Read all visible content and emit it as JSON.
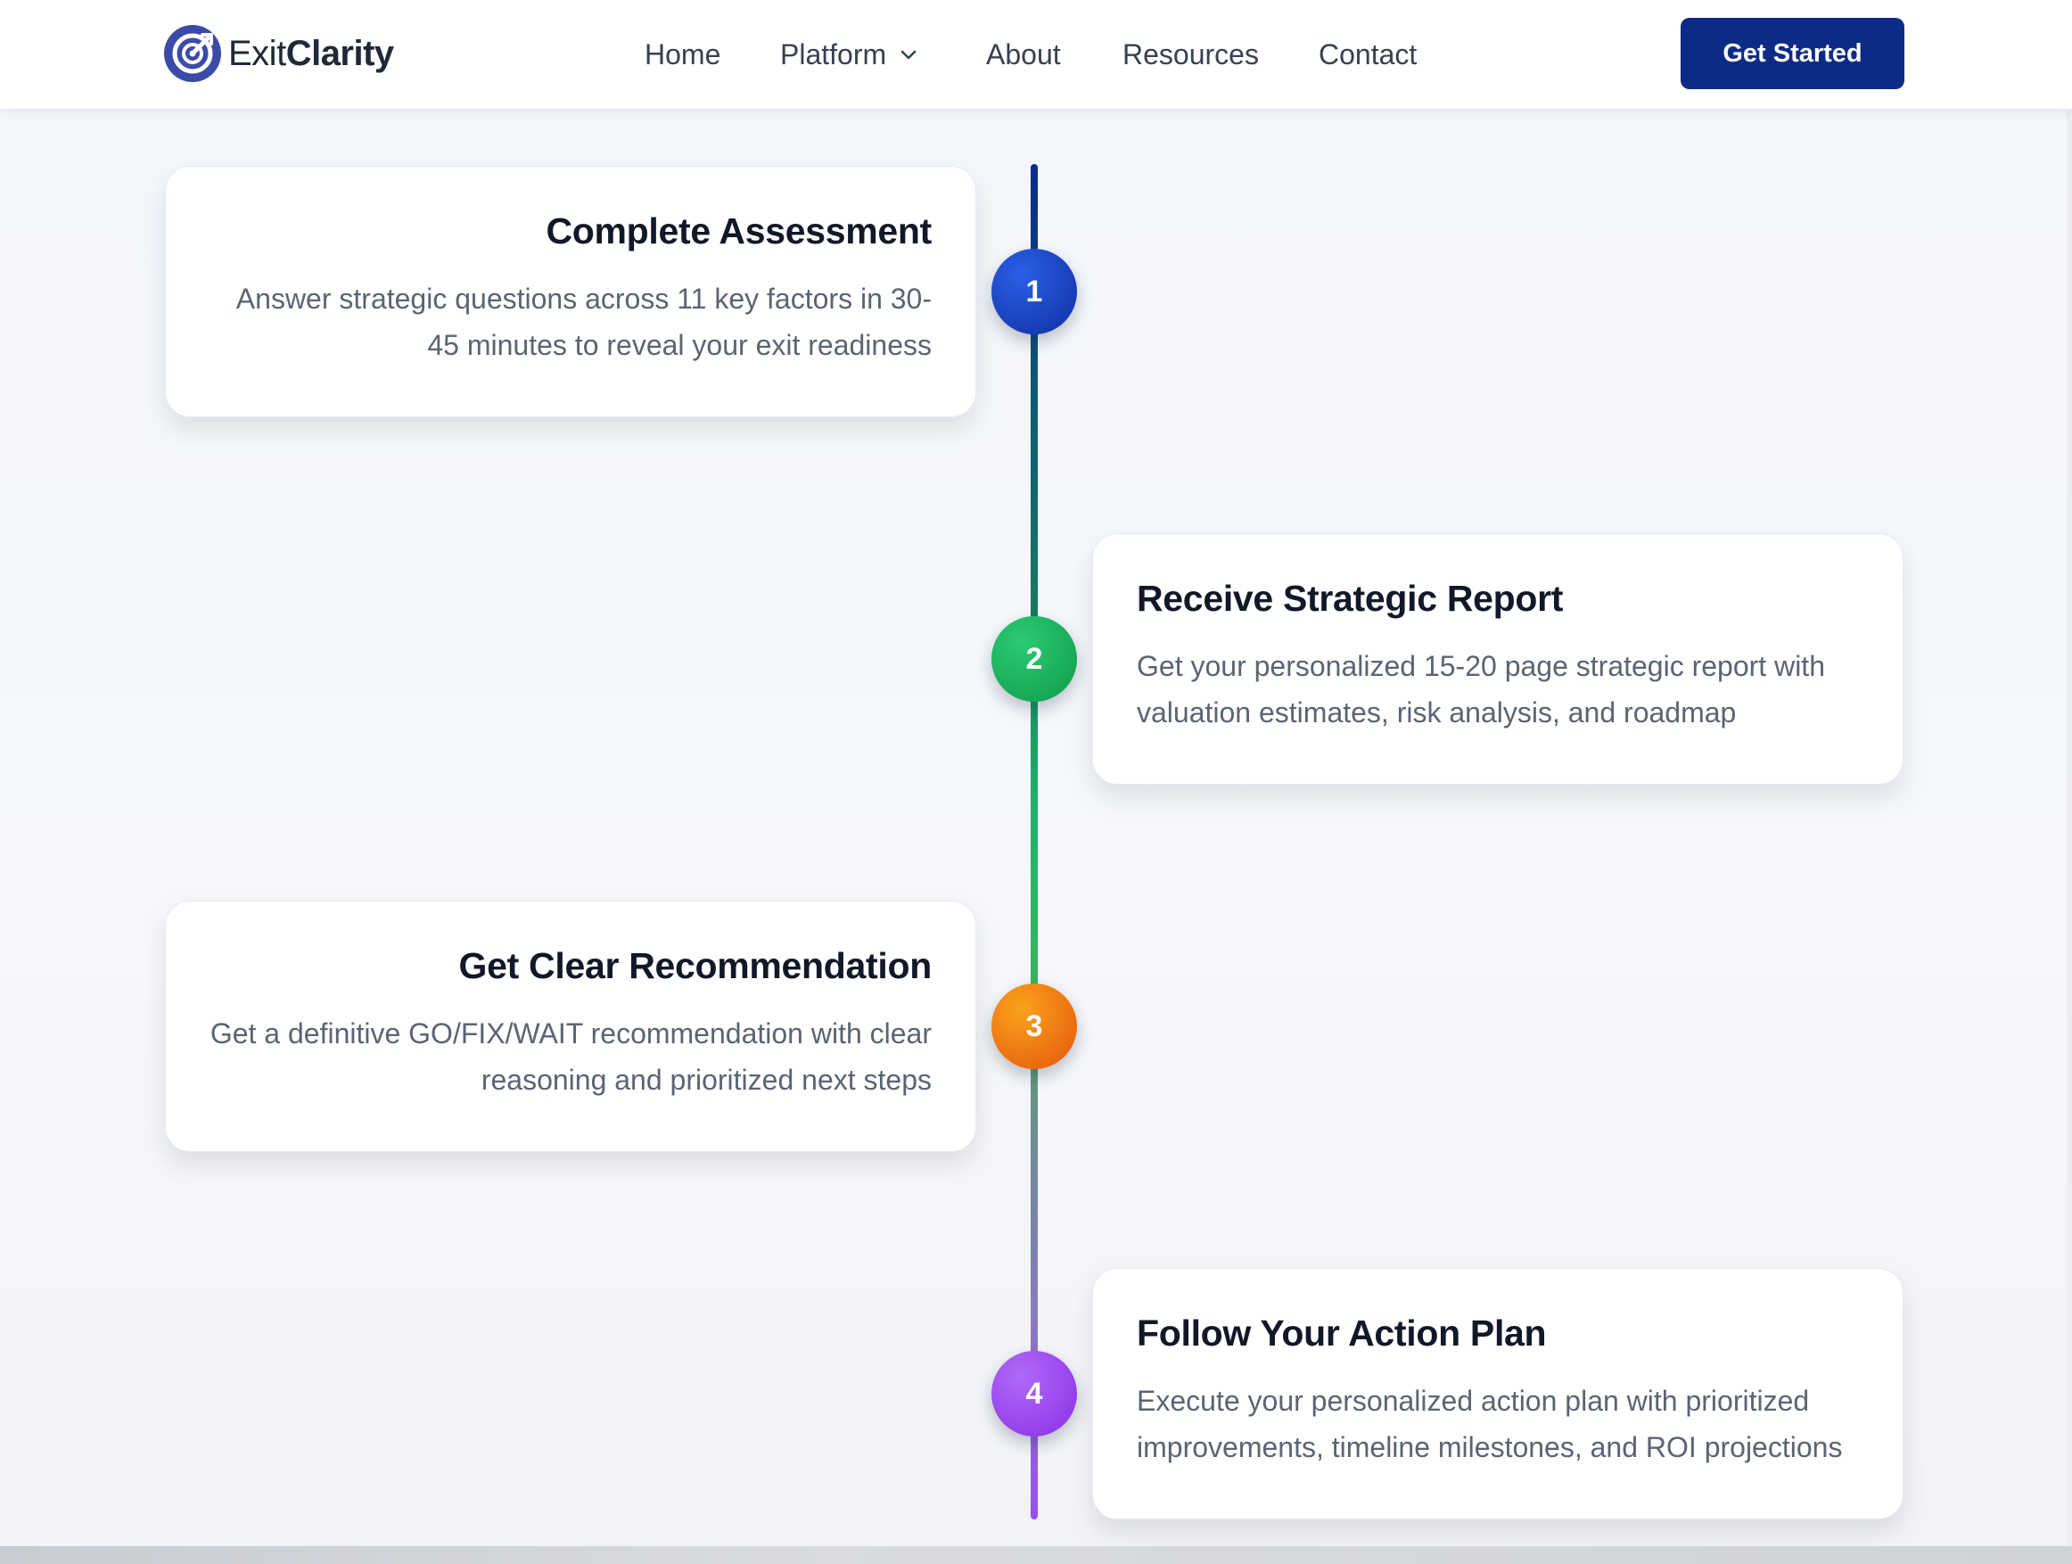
{
  "brand": {
    "name_light": "Exit",
    "name_bold": "Clarity",
    "logo_icon": "target-arrow-icon",
    "accent": "#3b4ba8"
  },
  "nav": {
    "items": [
      {
        "label": "Home"
      },
      {
        "label": "Platform",
        "icon": "chevron-down-icon"
      },
      {
        "label": "About"
      },
      {
        "label": "Resources"
      },
      {
        "label": "Contact"
      }
    ],
    "cta": "Get Started",
    "cta_color": "#0c2b86"
  },
  "steps": [
    {
      "number": "1",
      "title": "Complete Assessment",
      "description": "Answer strategic questions across 11 key factors in 30-45 minutes to reveal your exit readiness",
      "color": "#1d4ed8"
    },
    {
      "number": "2",
      "title": "Receive Strategic Report",
      "description": "Get your personalized 15-20 page strategic report with valuation estimates, risk analysis, and roadmap",
      "color": "#16a34a"
    },
    {
      "number": "3",
      "title": "Get Clear Recommendation",
      "description": "Get a definitive GO/FIX/WAIT recommendation with clear reasoning and prioritized next steps",
      "color": "#ea6a0c"
    },
    {
      "number": "4",
      "title": "Follow Your Action Plan",
      "description": "Execute your personalized action plan with prioritized improvements, timeline milestones, and ROI projections",
      "color": "#9333ea"
    }
  ]
}
